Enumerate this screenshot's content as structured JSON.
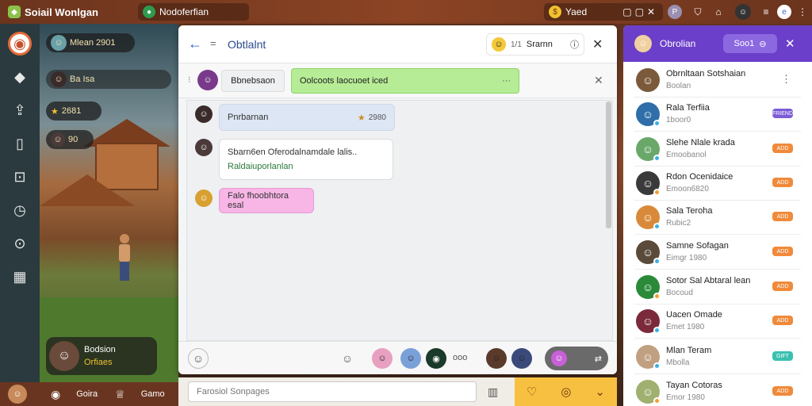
{
  "topbar": {
    "app_title": "Soiail Wonlgan",
    "status_text": "Nodoferfian",
    "coins_label": "Yaed",
    "right_icons": [
      "battery-icon",
      "user-icon",
      "shield-icon",
      "home-icon",
      "avatar",
      "browser-icon",
      "menu-icon"
    ]
  },
  "rail": {
    "icons": [
      "logo-icon",
      "chat-icon",
      "share-icon",
      "panel-icon",
      "edit-icon",
      "clock-icon",
      "shop-icon",
      "grid-icon"
    ]
  },
  "scene": {
    "player_name": "Mlean 2901",
    "stat_row": "Ba Isa",
    "stat_score": "2681",
    "stat_level": "90",
    "bottom_name": "Bodsion",
    "bottom_sub": "Orfiaes"
  },
  "bottombar": {
    "items": [
      "Goira",
      "Gamo"
    ]
  },
  "chat": {
    "title": "Obtlalnt",
    "header_count": "1/1",
    "header_status": "Srarnn",
    "sub_label": "Bbnebsaon",
    "sub_notice": "Oolcoots laocuoet iced",
    "messages": [
      {
        "text": "Pnrbarnan",
        "meta": "2980",
        "color": "#dde6f4"
      },
      {
        "text": "Sbarn6en Oferodalnamdale lalis..",
        "text2": "Raldaiuporlanlan",
        "color": "#ffffff"
      },
      {
        "text": "Falo fhoobhtora esal",
        "color": "#f7b6e6"
      }
    ],
    "footer_label": "ooo"
  },
  "friends": {
    "title": "Obrolian",
    "button_label": "Soo1",
    "list": [
      {
        "name": "Obrnltaan Sotshaian",
        "sub": "Boolan",
        "badge": "",
        "badge_color": "",
        "avatar_color": "#7a5a3a"
      },
      {
        "name": "Rala Terfiia",
        "sub": "1boor0",
        "badge": "FRIEND",
        "badge_color": "#7b5cd6",
        "avatar_color": "#2f6ea8"
      },
      {
        "name": "Slehe Nlale krada",
        "sub": "Emoobanol",
        "badge": "ADD",
        "badge_color": "#f08a3a",
        "avatar_color": "#6aa86a"
      },
      {
        "name": "Rdon Ocenidaice",
        "sub": "Emoon6820",
        "badge": "ADD",
        "badge_color": "#f08a3a",
        "avatar_color": "#3a3a3a"
      },
      {
        "name": "Sala Teroha",
        "sub": "Rubic2",
        "badge": "ADD",
        "badge_color": "#f08a3a",
        "avatar_color": "#d88a3a"
      },
      {
        "name": "Samne Sofagan",
        "sub": "Eimgr 1980",
        "badge": "ADD",
        "badge_color": "#f08a3a",
        "avatar_color": "#5a4a3a"
      },
      {
        "name": "Sotor Sal Abtaral lean",
        "sub": "Bocoud",
        "badge": "ADD",
        "badge_color": "#f08a3a",
        "avatar_color": "#2a8a3a"
      },
      {
        "name": "Uacen Omade",
        "sub": "Emet 1980",
        "badge": "ADD",
        "badge_color": "#f08a3a",
        "avatar_color": "#7a2a3a"
      },
      {
        "name": "Mlan Teram",
        "sub": "Mbolla",
        "badge": "GIFT",
        "badge_color": "#3ac0b0",
        "avatar_color": "#c0a080"
      },
      {
        "name": "Tayan Cotoras",
        "sub": "Emor 1980",
        "badge": "ADD",
        "badge_color": "#f08a3a",
        "avatar_color": "#a0b070"
      }
    ]
  },
  "input": {
    "placeholder": "Farosiol Sonpages"
  }
}
